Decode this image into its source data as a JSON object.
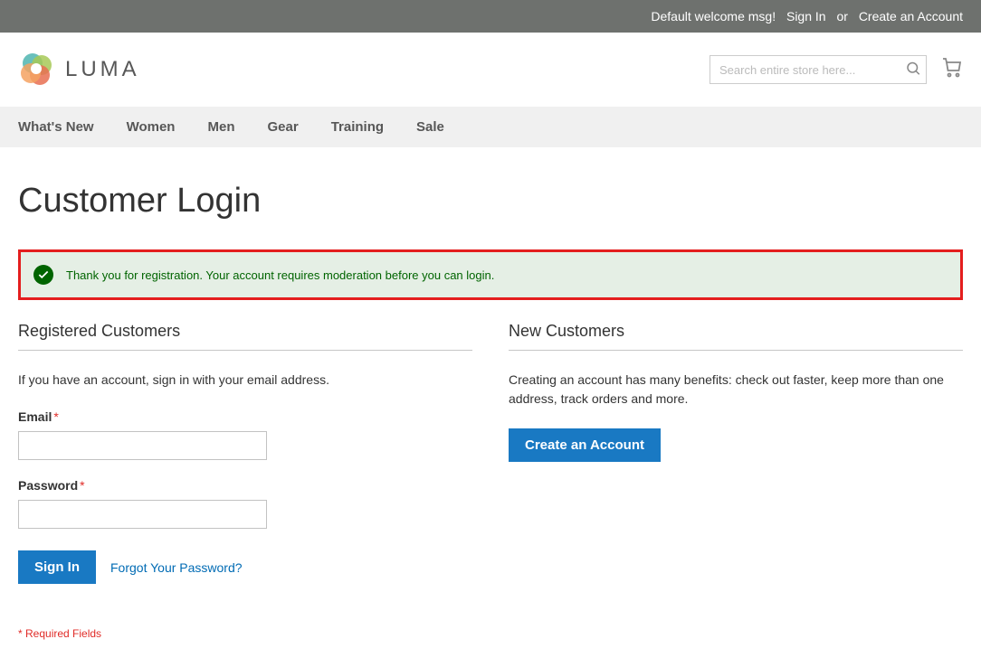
{
  "topbar": {
    "welcome": "Default welcome msg!",
    "sign_in": "Sign In",
    "or": "or",
    "create_account": "Create an Account"
  },
  "logo": {
    "text": "LUMA"
  },
  "search": {
    "placeholder": "Search entire store here..."
  },
  "nav": {
    "items": [
      "What's New",
      "Women",
      "Men",
      "Gear",
      "Training",
      "Sale"
    ]
  },
  "page": {
    "title": "Customer Login"
  },
  "alert": {
    "message": "Thank you for registration. Your account requires moderation before you can login."
  },
  "registered": {
    "title": "Registered Customers",
    "desc": "If you have an account, sign in with your email address.",
    "email_label": "Email",
    "password_label": "Password",
    "sign_in_btn": "Sign In",
    "forgot_link": "Forgot Your Password?",
    "required_note": "* Required Fields"
  },
  "newcust": {
    "title": "New Customers",
    "desc": "Creating an account has many benefits: check out faster, keep more than one address, track orders and more.",
    "create_btn": "Create an Account"
  }
}
